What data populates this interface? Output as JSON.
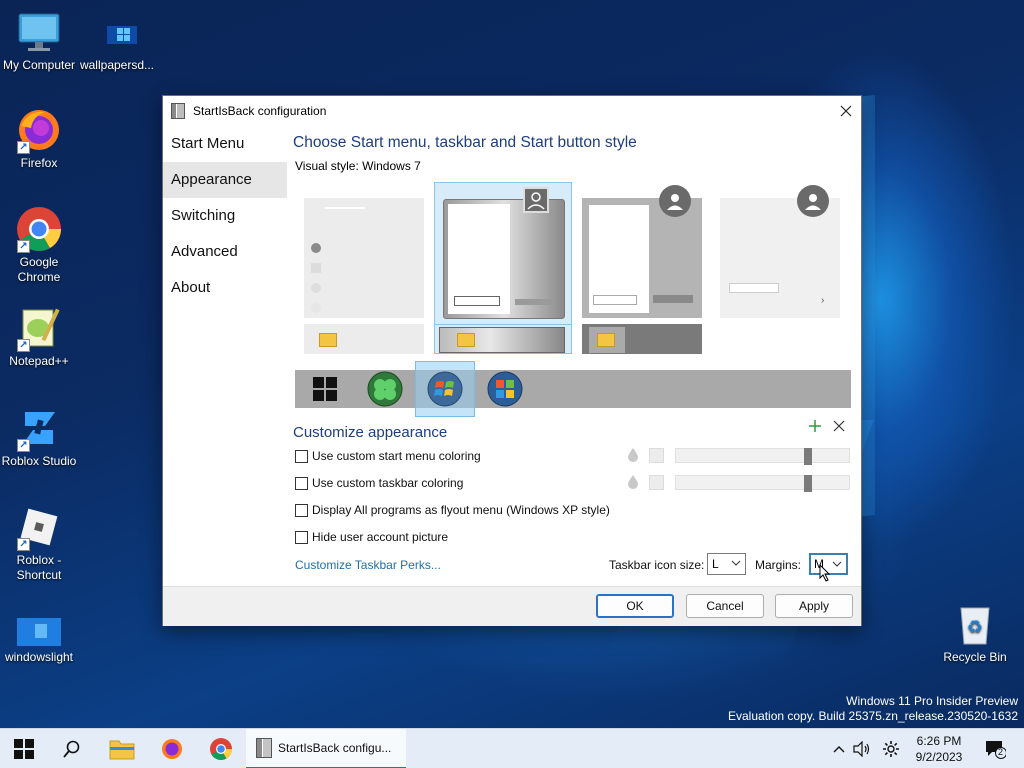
{
  "desktop": {
    "icons": [
      {
        "label": "My Computer",
        "icon": "monitor-icon"
      },
      {
        "label": "wallpapersd...",
        "icon": "windows-logo-icon"
      },
      {
        "label": "Firefox",
        "icon": "firefox-icon"
      },
      {
        "label": "Google Chrome",
        "icon": "chrome-icon"
      },
      {
        "label": "Notepad++",
        "icon": "notepadpp-icon"
      },
      {
        "label": "Roblox Studio",
        "icon": "roblox-studio-icon"
      },
      {
        "label": "Roblox - Shortcut",
        "icon": "roblox-icon"
      },
      {
        "label": "windowslight",
        "icon": "windows-light-icon"
      },
      {
        "label": "Recycle Bin",
        "icon": "recycle-bin-icon"
      }
    ],
    "watermark": {
      "line1": "Windows 11 Pro Insider Preview",
      "line2": "Evaluation copy. Build 25375.zn_release.230520-1632"
    }
  },
  "dialog": {
    "title": "StartIsBack configuration",
    "nav": [
      {
        "label": "Start Menu",
        "selected": false
      },
      {
        "label": "Appearance",
        "selected": true
      },
      {
        "label": "Switching",
        "selected": false
      },
      {
        "label": "Advanced",
        "selected": false
      },
      {
        "label": "About",
        "selected": false
      }
    ],
    "heading": "Choose Start menu, taskbar and Start button style",
    "visual_style": "Visual style:  Windows 7",
    "selected_style_index": 1,
    "selected_logo_index": 2,
    "customize": {
      "heading": "Customize appearance",
      "options": [
        {
          "label": "Use custom start menu coloring",
          "checked": false
        },
        {
          "label": "Use custom taskbar coloring",
          "checked": false
        },
        {
          "label": "Display All programs as flyout menu (Windows XP style)",
          "checked": false
        },
        {
          "label": "Hide user account picture",
          "checked": false
        }
      ],
      "link": "Customize Taskbar Perks...",
      "icon_size_label": "Taskbar icon size:",
      "icon_size_value": "L",
      "margins_label": "Margins:",
      "margins_value": "M"
    },
    "buttons": {
      "ok": "OK",
      "cancel": "Cancel",
      "apply": "Apply"
    }
  },
  "taskbar": {
    "app_label": "StartIsBack configu...",
    "time": "6:26 PM",
    "date": "9/2/2023",
    "notification_count": "2"
  },
  "colors": {
    "accent": "#1a73c9",
    "heading": "#1e3e80",
    "link": "#1f6fa8"
  }
}
